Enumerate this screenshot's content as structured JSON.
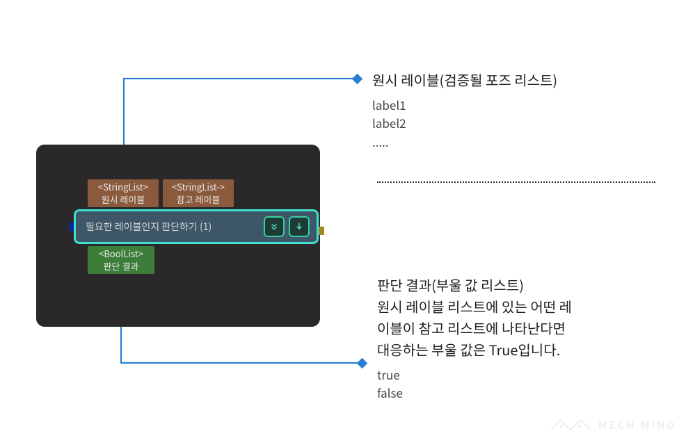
{
  "node": {
    "input1": {
      "type": "<StringList>",
      "label": "원시 레이블"
    },
    "input2": {
      "type": "<StringList->",
      "label": "참고 레이블"
    },
    "title": "필요한 레이블인지 판단하기 (1)",
    "output": {
      "type": "<BoolList>",
      "label": "판단 결과"
    }
  },
  "anno1": {
    "heading": "원시 레이블(검증될 포즈 리스트)",
    "line1": "label1",
    "line2": "label2",
    "line3": "....."
  },
  "anno2": {
    "heading_l1": "판단 결과(부울 값 리스트)",
    "heading_l2": "원시 레이블 리스트에 있는 어떤 레",
    "heading_l3": "이블이 참고 리스트에 나타난다면",
    "heading_l4": "대응하는 부울 값은 True입니다.",
    "line1": "true",
    "line2": "false"
  },
  "watermark": "MECH MIND"
}
